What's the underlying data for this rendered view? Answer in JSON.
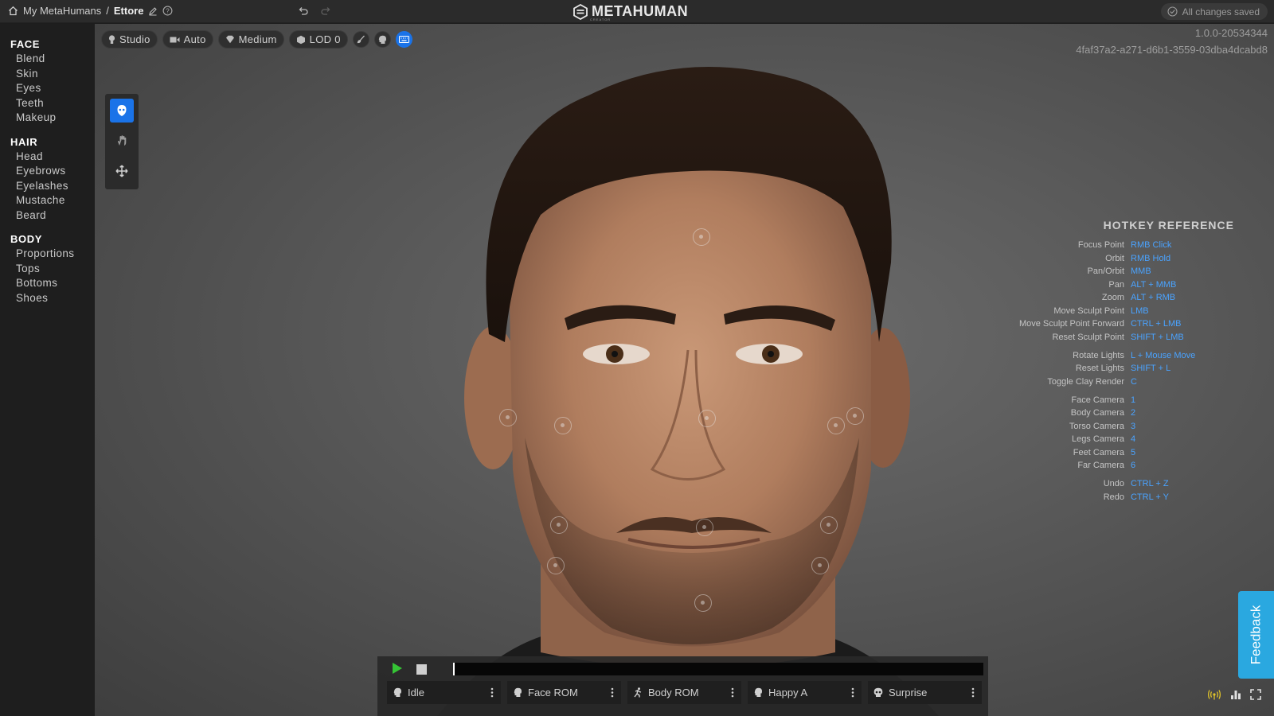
{
  "header": {
    "breadcrumb_root": "My MetaHumans",
    "separator": "/",
    "character_name": "Ettore",
    "logo_text": "METAHUMAN",
    "logo_subtext": "CREATOR",
    "save_status": "All changes saved",
    "icons": [
      "home-icon",
      "edit-icon",
      "help-icon",
      "undo-icon",
      "redo-icon",
      "check-circle-icon"
    ]
  },
  "sidebar": {
    "sections": [
      {
        "title": "FACE",
        "items": [
          "Blend",
          "Skin",
          "Eyes",
          "Teeth",
          "Makeup"
        ]
      },
      {
        "title": "HAIR",
        "items": [
          "Head",
          "Eyebrows",
          "Eyelashes",
          "Mustache",
          "Beard"
        ]
      },
      {
        "title": "BODY",
        "items": [
          "Proportions",
          "Tops",
          "Bottoms",
          "Shoes"
        ]
      }
    ]
  },
  "viewport_toolbar": {
    "lighting": "Studio",
    "camera": "Auto",
    "quality": "Medium",
    "lod": "LOD 0"
  },
  "version": {
    "build": "1.0.0-20534344",
    "id": "4faf37a2-a271-d6b1-3559-03dba4dcabd8"
  },
  "tools": [
    "sculpt-face-icon",
    "move-hand-icon",
    "pan-arrows-icon"
  ],
  "hotkeys": {
    "title": "HOTKEY REFERENCE",
    "groups": [
      [
        {
          "action": "Focus Point",
          "key": "RMB Click"
        },
        {
          "action": "Orbit",
          "key": "RMB Hold"
        },
        {
          "action": "Pan/Orbit",
          "key": "MMB"
        },
        {
          "action": "Pan",
          "key": "ALT + MMB"
        },
        {
          "action": "Zoom",
          "key": "ALT + RMB"
        },
        {
          "action": "Move Sculpt Point",
          "key": "LMB"
        },
        {
          "action": "Move Sculpt Point Forward",
          "key": "CTRL + LMB"
        },
        {
          "action": "Reset Sculpt Point",
          "key": "SHIFT + LMB"
        }
      ],
      [
        {
          "action": "Rotate Lights",
          "key": "L + Mouse Move"
        },
        {
          "action": "Reset Lights",
          "key": "SHIFT + L"
        },
        {
          "action": "Toggle Clay Render",
          "key": "C"
        }
      ],
      [
        {
          "action": "Face Camera",
          "key": "1"
        },
        {
          "action": "Body Camera",
          "key": "2"
        },
        {
          "action": "Torso Camera",
          "key": "3"
        },
        {
          "action": "Legs Camera",
          "key": "4"
        },
        {
          "action": "Feet Camera",
          "key": "5"
        },
        {
          "action": "Far Camera",
          "key": "6"
        }
      ],
      [
        {
          "action": "Undo",
          "key": "CTRL + Z"
        },
        {
          "action": "Redo",
          "key": "CTRL + Y"
        }
      ]
    ]
  },
  "animation": {
    "progress": 0.0,
    "clips": [
      {
        "label": "Idle",
        "icon": "face-icon"
      },
      {
        "label": "Face ROM",
        "icon": "face-icon"
      },
      {
        "label": "Body ROM",
        "icon": "running-figure-icon"
      },
      {
        "label": "Happy A",
        "icon": "face-icon"
      },
      {
        "label": "Surprise",
        "icon": "skull-icon"
      }
    ]
  },
  "feedback": {
    "label": "Feedback"
  },
  "colors": {
    "accent": "#1a73e8",
    "hotkey": "#4aa3ff",
    "play": "#35c435",
    "feedback": "#2aa8e0"
  }
}
